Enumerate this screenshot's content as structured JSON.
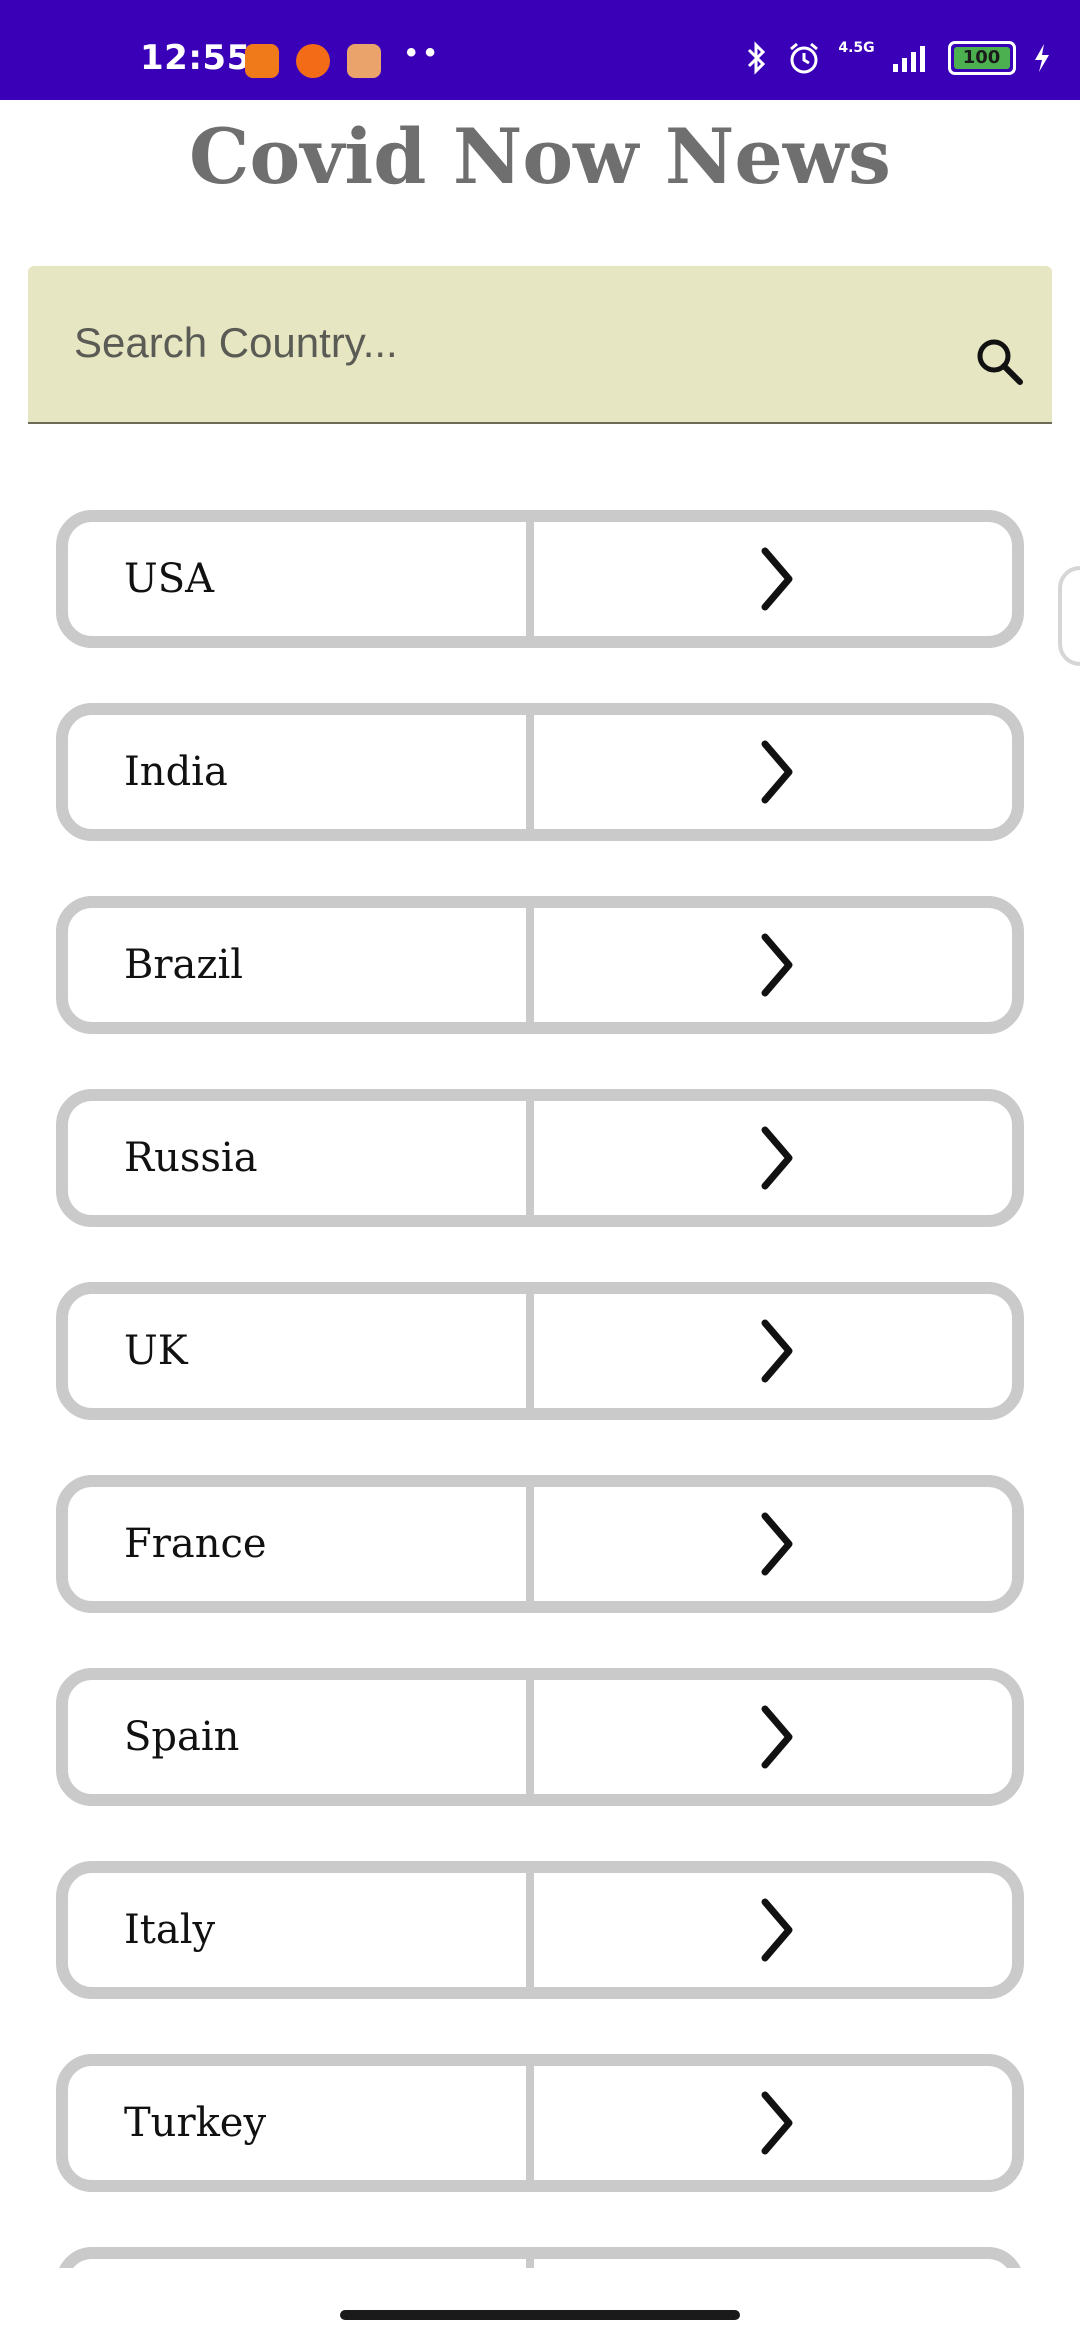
{
  "status_bar": {
    "time": "12:55",
    "network": "4.5G",
    "battery": "100",
    "bg_color": "#3a00b8"
  },
  "app": {
    "title": "Covid Now News"
  },
  "search": {
    "placeholder": "Search Country...",
    "value": "",
    "icon": "search-icon"
  },
  "countries": [
    {
      "label": "USA"
    },
    {
      "label": "India"
    },
    {
      "label": "Brazil"
    },
    {
      "label": "Russia"
    },
    {
      "label": "UK"
    },
    {
      "label": "France"
    },
    {
      "label": "Spain"
    },
    {
      "label": "Italy"
    },
    {
      "label": "Turkey"
    },
    {
      "label": ""
    }
  ],
  "colors": {
    "row_border": "#cacaca",
    "search_bg": "#e6e6c2",
    "title": "#6f6f6f"
  }
}
